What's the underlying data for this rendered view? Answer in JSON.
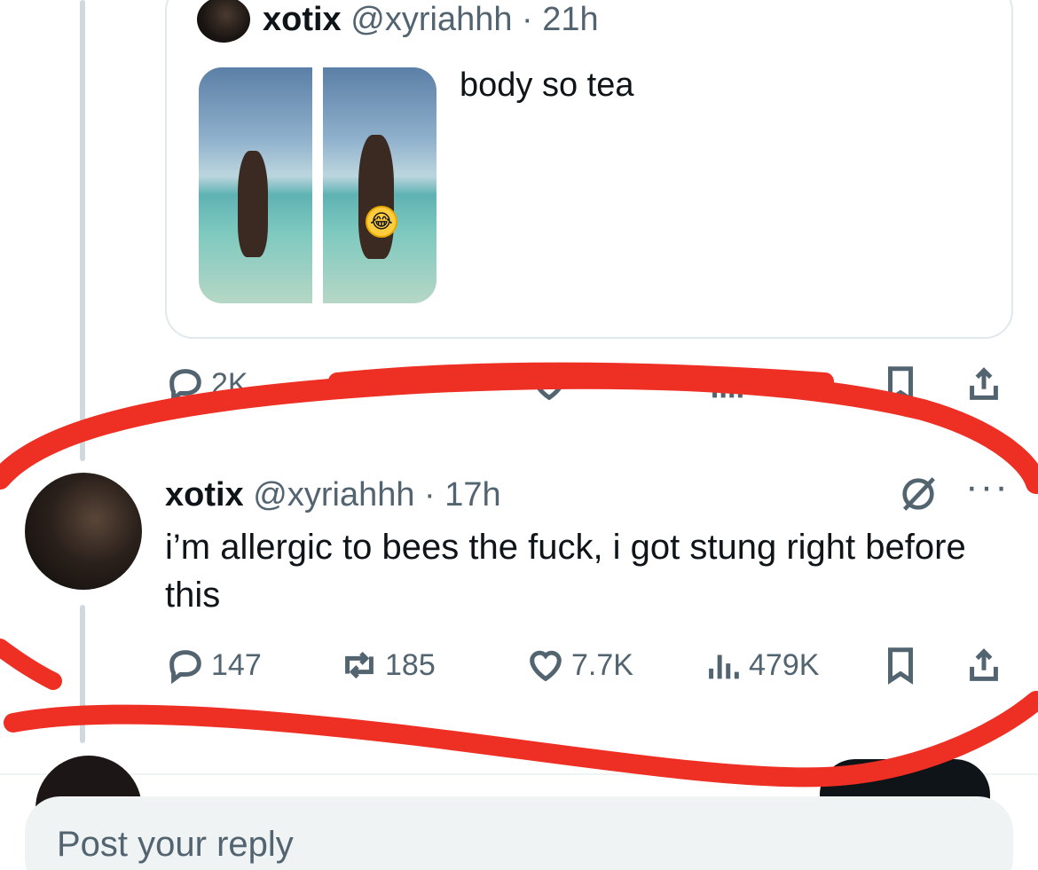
{
  "quoted_tweet": {
    "author_name": "xotix",
    "handle": "@xyriahhh",
    "time": "· 21h",
    "text": "body so tea",
    "media": [
      "beach-photo-front",
      "beach-photo-back"
    ],
    "actions": {
      "replies": "2K",
      "reposts": "",
      "likes": "",
      "views": ""
    }
  },
  "main_tweet": {
    "author_name": "xotix",
    "handle": "@xyriahhh",
    "time": "· 17h",
    "text": "i’m allergic to bees the fuck, i got stung right before this",
    "actions": {
      "replies": "147",
      "reposts": "185",
      "likes": "7.7K",
      "views": "479K"
    }
  },
  "reply_box": {
    "placeholder": "Post your reply"
  },
  "icons": [
    "reply-icon",
    "repost-icon",
    "like-icon",
    "views-icon",
    "bookmark-icon",
    "share-icon",
    "grok-icon",
    "more-icon"
  ],
  "colors": {
    "text": "#0f1419",
    "secondary": "#536471",
    "annotation_red": "#ee2f24"
  }
}
